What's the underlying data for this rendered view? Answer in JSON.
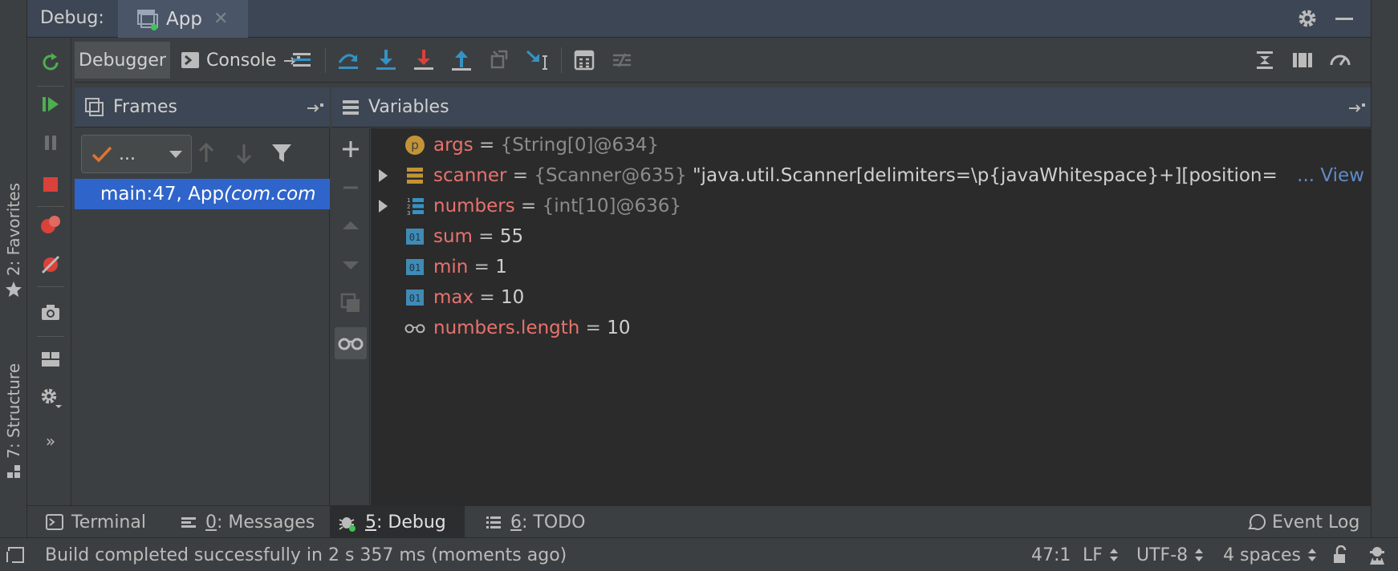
{
  "debug_header": {
    "title": "Debug:",
    "tab_label": "App"
  },
  "left_strip": {
    "favorites_label": "2: Favorites",
    "structure_label": "7: Structure"
  },
  "toolbar": {
    "debugger_tab": "Debugger",
    "console_tab": "Console"
  },
  "frames": {
    "header": "Frames",
    "thread_select_value": "...",
    "selected_frame_main": "main:47, App ",
    "selected_frame_pkg": "(com.com"
  },
  "variables": {
    "header": "Variables",
    "rows": [
      {
        "name": "args",
        "eq": " = ",
        "ref": "{String[0]@634}",
        "value": "",
        "icon": "parameter-icon",
        "expandable": false
      },
      {
        "name": "scanner",
        "eq": " = ",
        "ref": "{Scanner@635}",
        "value": " \"java.util.Scanner[delimiters=\\p{javaWhitespace}+][position=",
        "ellipsis": "... ",
        "link": "View",
        "icon": "object-icon",
        "expandable": true
      },
      {
        "name": "numbers",
        "eq": " = ",
        "ref": "{int[10]@636}",
        "value": "",
        "icon": "array-icon",
        "expandable": true
      },
      {
        "name": "sum",
        "eq": " = ",
        "ref": "",
        "value": "55",
        "icon": "primitive-icon",
        "expandable": false
      },
      {
        "name": "min",
        "eq": " = ",
        "ref": "",
        "value": "1",
        "icon": "primitive-icon",
        "expandable": false
      },
      {
        "name": "max",
        "eq": " = ",
        "ref": "",
        "value": "10",
        "icon": "primitive-icon",
        "expandable": false
      },
      {
        "name": "numbers.length",
        "eq": " = ",
        "ref": "",
        "value": "10",
        "icon": "watch-icon",
        "expandable": false
      }
    ]
  },
  "bottom_tabs": {
    "terminal": "Terminal",
    "messages_num": "0",
    "messages_rest": ": Messages",
    "debug_num": "5",
    "debug_rest": ": Debug",
    "todo_num": "6",
    "todo_rest": ": TODO",
    "event_log": "Event Log"
  },
  "status": {
    "message": "Build completed successfully in 2 s 357 ms (moments ago)",
    "position": "47:1",
    "line_sep": "LF",
    "encoding": "UTF-8",
    "indent": "4 spaces"
  },
  "colors": {
    "accent_selection": "#2f65ca",
    "variable_name": "#e8726d",
    "link": "#5f8bc9",
    "resume_green": "#4caf50",
    "stop_red": "#d9423a"
  }
}
